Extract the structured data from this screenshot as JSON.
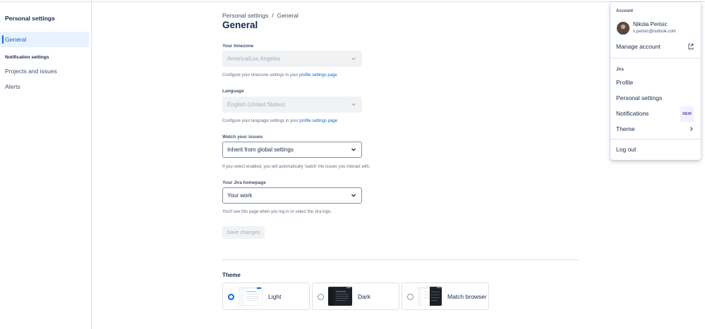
{
  "sidebar": {
    "title": "Personal settings",
    "items": [
      {
        "label": "General"
      },
      {
        "label": "Projects and issues"
      },
      {
        "label": "Alerts"
      }
    ],
    "section_label": "Notification settings"
  },
  "breadcrumb": {
    "parent": "Personal settings",
    "separator": "/",
    "current": "General"
  },
  "page": {
    "title": "General"
  },
  "form": {
    "timezone": {
      "label": "Your timezone",
      "value": "America/Los Angeles",
      "helper_text": "Configure your timezone settings in your",
      "helper_link": "profile settings page"
    },
    "language": {
      "label": "Language",
      "value": "English (United States)",
      "helper_text": "Configure your language settings in your",
      "helper_link": "profile settings page"
    },
    "watch": {
      "label": "Watch your issues",
      "value": "Inherit from global settings",
      "helper_text": "If you select enabled, you will automatically 'watch' the issues you interact with."
    },
    "homepage": {
      "label": "Your Jira homepage",
      "value": "Your work",
      "helper_text": "You'll see this page when you log in or select the Jira logo."
    },
    "save_label": "Save changes"
  },
  "theme": {
    "title": "Theme",
    "options": [
      {
        "label": "Light",
        "selected": true
      },
      {
        "label": "Dark",
        "selected": false
      },
      {
        "label": "Match browser",
        "selected": false
      }
    ]
  },
  "account_menu": {
    "account_section": "Account",
    "user_name": "Nikola Perisic",
    "user_email": "n.perisic@outlook.com",
    "manage_account": "Manage account",
    "jira_section": "Jira",
    "items": [
      {
        "label": "Profile"
      },
      {
        "label": "Personal settings"
      },
      {
        "label": "Notifications",
        "badge": "NEW"
      },
      {
        "label": "Theme"
      }
    ],
    "logout": "Log out"
  },
  "colors": {
    "accent": "#0c66e4",
    "text": "#172b4d",
    "border": "#dfe1e6"
  }
}
